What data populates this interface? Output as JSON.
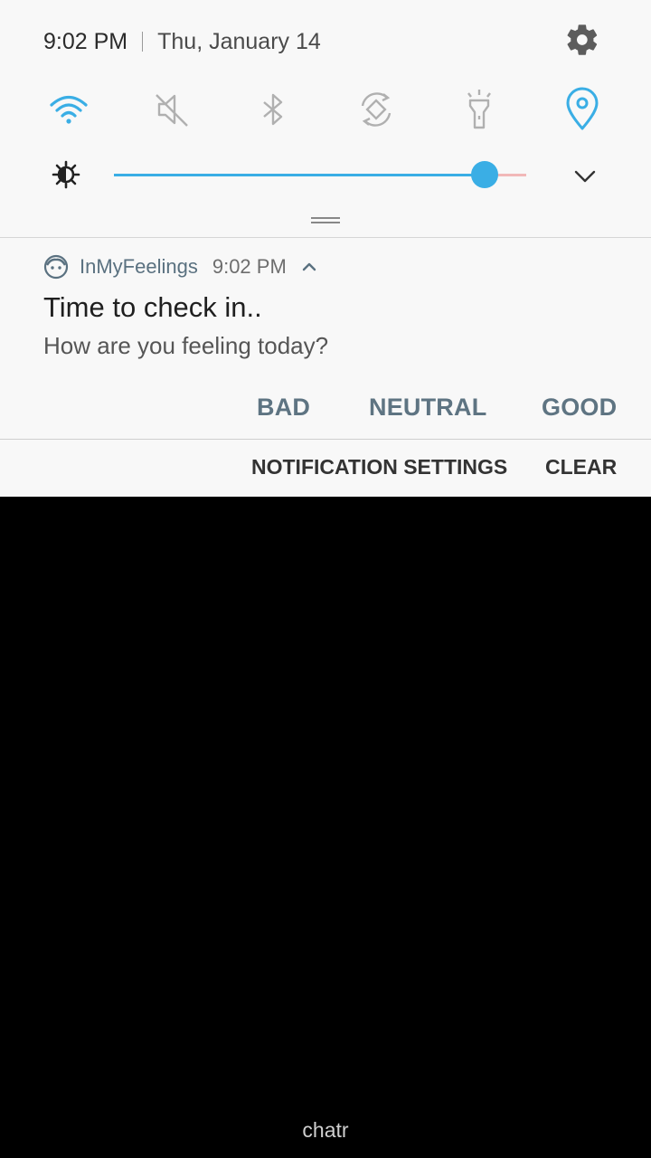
{
  "status": {
    "time": "9:02 PM",
    "date": "Thu, January 14"
  },
  "quick_toggles": [
    {
      "icon": "wifi-icon",
      "active": true
    },
    {
      "icon": "mute-icon",
      "active": false
    },
    {
      "icon": "bluetooth-icon",
      "active": false
    },
    {
      "icon": "auto-rotate-icon",
      "active": false
    },
    {
      "icon": "flashlight-icon",
      "active": false
    },
    {
      "icon": "location-icon",
      "active": true
    }
  ],
  "brightness": {
    "level": 0.9
  },
  "notification": {
    "app_name": "InMyFeelings",
    "time": "9:02 PM",
    "title": "Time to check in..",
    "body": "How are you feeling today?",
    "actions": [
      "BAD",
      "NEUTRAL",
      "GOOD"
    ]
  },
  "footer": {
    "settings_label": "NOTIFICATION SETTINGS",
    "clear_label": "CLEAR"
  },
  "carrier": "chatr",
  "colors": {
    "accent": "#3aaee5",
    "inactive_icon": "#b0b0b0",
    "action_text": "#5e7482"
  }
}
